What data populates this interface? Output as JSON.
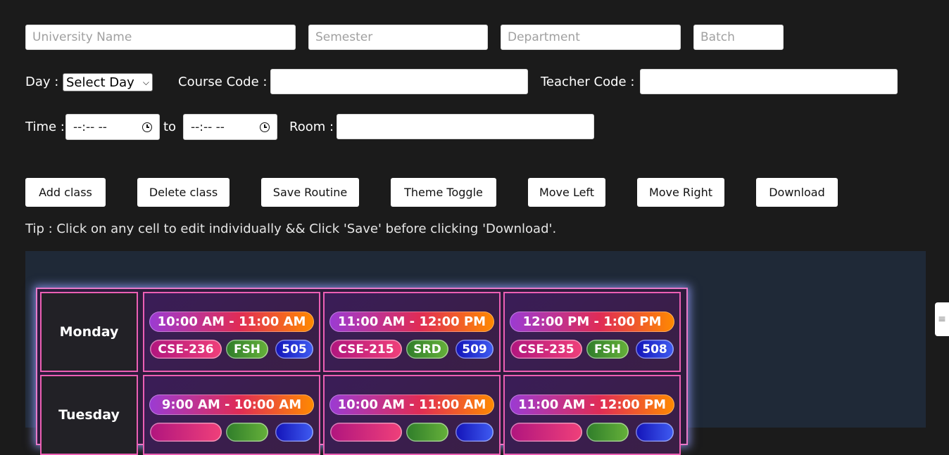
{
  "form": {
    "university_placeholder": "University Name",
    "semester_placeholder": "Semester",
    "department_placeholder": "Department",
    "batch_placeholder": "Batch",
    "day_label": "Day :",
    "day_select_value": "Select Day",
    "course_code_label": "Course Code :",
    "teacher_code_label": "Teacher Code :",
    "time_label": "Time :",
    "time_start_value": "--:-- --",
    "to_label": "to",
    "time_end_value": "--:-- --",
    "room_label": "Room :"
  },
  "buttons": {
    "add": "Add class",
    "delete": "Delete class",
    "save": "Save Routine",
    "theme": "Theme Toggle",
    "left": "Move Left",
    "right": "Move Right",
    "download": "Download"
  },
  "tip": "Tip : Click on any cell to edit individually && Click 'Save' before clicking 'Download'.",
  "routine": [
    {
      "day": "Monday",
      "slots": [
        {
          "time": "10:00 AM - 11:00 AM",
          "code": "CSE-236",
          "teacher": "FSH",
          "room": "505"
        },
        {
          "time": "11:00 AM - 12:00 PM",
          "code": "CSE-215",
          "teacher": "SRD",
          "room": "509"
        },
        {
          "time": "12:00 PM - 1:00 PM",
          "code": "CSE-235",
          "teacher": "FSH",
          "room": "508"
        }
      ]
    },
    {
      "day": "Tuesday",
      "slots": [
        {
          "time": "9:00 AM - 10:00 AM",
          "code": "",
          "teacher": "",
          "room": ""
        },
        {
          "time": "10:00 AM - 11:00 AM",
          "code": "",
          "teacher": "",
          "room": ""
        },
        {
          "time": "11:00 AM - 12:00 PM",
          "code": "",
          "teacher": "",
          "room": ""
        }
      ]
    }
  ],
  "side_tab_icon": "grip-icon",
  "colors": {
    "background": "#1b1b1b",
    "panel": "#1f2937",
    "cell_border": "#ec5fb4",
    "time_gradient": [
      "#9b3bd3",
      "#e02c55",
      "#ff8a00"
    ],
    "code_pill": "#d12a7e",
    "teacher_pill": "#4a9631",
    "room_pill": "#2a36d6"
  }
}
